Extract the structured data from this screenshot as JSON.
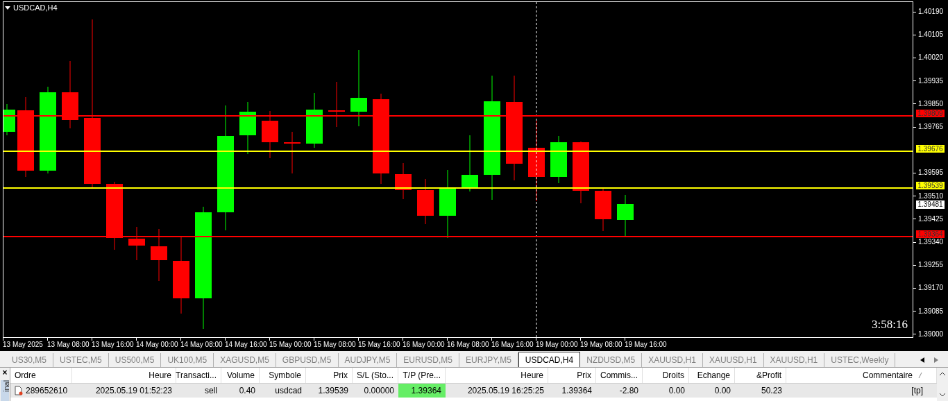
{
  "chart": {
    "title": "USDCAD,H4",
    "timer": "3:58:16",
    "price_ticks": [
      "1.40190",
      "1.40105",
      "1.40020",
      "1.39935",
      "1.39850",
      "1.39765",
      "1.39595",
      "1.39510",
      "1.39425",
      "1.39340",
      "1.39255",
      "1.39170",
      "1.39085",
      "1.39000"
    ],
    "time_ticks": [
      "13 May 2025",
      "13 May 08:00",
      "13 May 16:00",
      "14 May 00:00",
      "14 May 08:00",
      "14 May 16:00",
      "15 May 00:00",
      "15 May 08:00",
      "15 May 16:00",
      "16 May 00:00",
      "16 May 08:00",
      "16 May 16:00",
      "19 May 00:00",
      "19 May 08:00",
      "19 May 16:00"
    ],
    "levels": [
      {
        "label": "1.39809",
        "color": "#ff0000"
      },
      {
        "label": "1.39676",
        "color": "#ffff00"
      },
      {
        "label": "1.39539",
        "color": "#ffff00"
      },
      {
        "label": "1.39364",
        "color": "#ff0000"
      }
    ],
    "current_price": "1.39481"
  },
  "tabs": [
    {
      "label": "US30,M5",
      "selected": false
    },
    {
      "label": "USTEC,M5",
      "selected": false
    },
    {
      "label": "US500,M5",
      "selected": false
    },
    {
      "label": "UK100,M5",
      "selected": false
    },
    {
      "label": "XAGUSD,M5",
      "selected": false
    },
    {
      "label": "GBPUSD,M5",
      "selected": false
    },
    {
      "label": "AUDJPY,M5",
      "selected": false
    },
    {
      "label": "EURUSD,M5",
      "selected": false
    },
    {
      "label": "EURJPY,M5",
      "selected": false
    },
    {
      "label": "USDCAD,H4",
      "selected": true
    },
    {
      "label": "NZDUSD,M5",
      "selected": false
    },
    {
      "label": "XAUUSD,H1",
      "selected": false
    },
    {
      "label": "XAUUSD,H1",
      "selected": false
    },
    {
      "label": "XAUUSD,H1",
      "selected": false
    },
    {
      "label": "USTEC,Weekly",
      "selected": false
    }
  ],
  "terminal": {
    "close": "×",
    "side_label": "inal",
    "columns": [
      "Ordre",
      "Heure",
      "Transacti...",
      "Volume",
      "Symbole",
      "Prix",
      "S/L (Sto...",
      "T/P (Pre...",
      "Heure",
      "Prix",
      "Commis...",
      "Droits",
      "Echange",
      "&Profit",
      "Commentaire"
    ],
    "rows": [
      {
        "cells": [
          {
            "text": "289652610",
            "highlighted": false
          },
          {
            "text": "2025.05.19 01:52:23",
            "highlighted": false
          },
          {
            "text": "sell",
            "highlighted": false
          },
          {
            "text": "0.40",
            "highlighted": false
          },
          {
            "text": "usdcad",
            "highlighted": false
          },
          {
            "text": "1.39539",
            "highlighted": false
          },
          {
            "text": "0.00000",
            "highlighted": false
          },
          {
            "text": "1.39364",
            "highlighted": true
          },
          {
            "text": "2025.05.19 16:25:25",
            "highlighted": false
          },
          {
            "text": "1.39364",
            "highlighted": false
          },
          {
            "text": "-2.80",
            "highlighted": false
          },
          {
            "text": "0.00",
            "highlighted": false
          },
          {
            "text": "0.00",
            "highlighted": false
          },
          {
            "text": "50.23",
            "highlighted": false
          },
          {
            "text": "[tp]",
            "highlighted": false
          }
        ]
      }
    ]
  }
}
